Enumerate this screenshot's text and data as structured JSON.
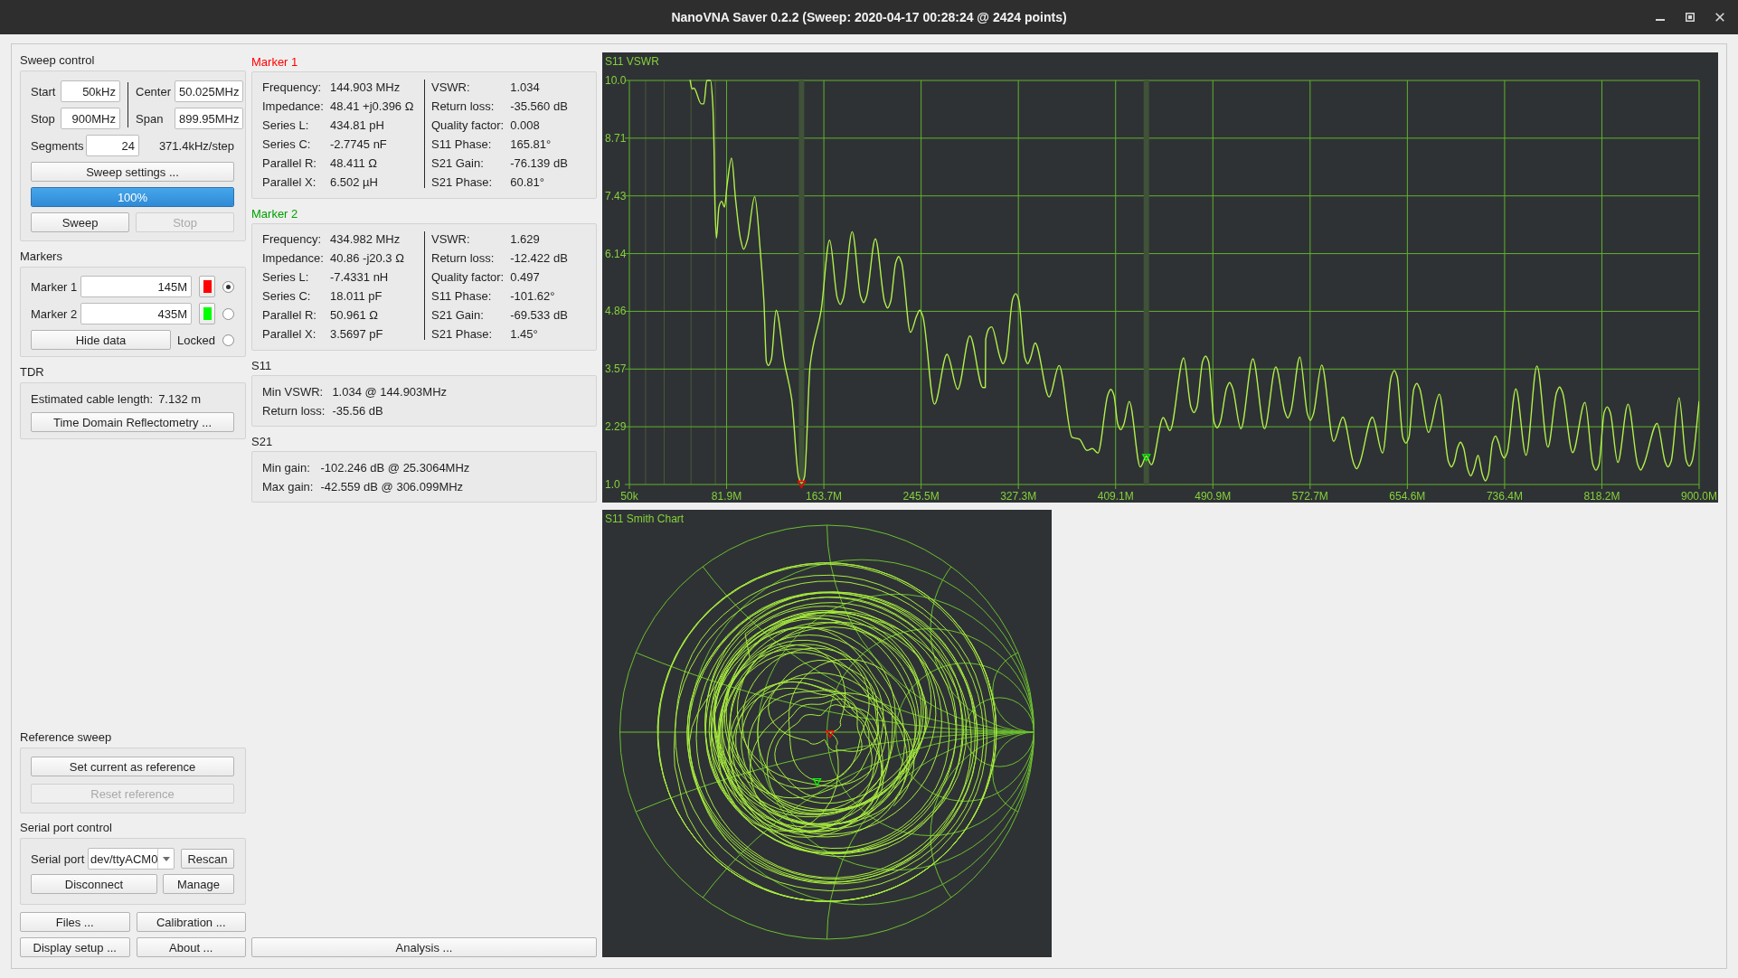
{
  "window": {
    "title": "NanoVNA Saver 0.2.2 (Sweep: 2020-04-17 00:28:24 @ 2424 points)"
  },
  "sweep_control": {
    "title": "Sweep control",
    "fields": [
      {
        "label": "Start",
        "value": "50kHz"
      },
      {
        "label": "Center",
        "value": "50.025MHz"
      },
      {
        "label": "Stop",
        "value": "900MHz"
      },
      {
        "label": "Span",
        "value": "899.95MHz"
      }
    ],
    "segments": {
      "label": "Segments",
      "value": "24",
      "step": "371.4kHz/step"
    },
    "settings_button": "Sweep settings ...",
    "progress": {
      "level": 1,
      "text": "100%"
    },
    "buttons": [
      {
        "label": "Sweep",
        "disabled": false
      },
      {
        "label": "Stop",
        "disabled": true
      }
    ]
  },
  "markers": {
    "title": "Markers",
    "items": [
      {
        "label": "Marker 1",
        "value": "145M",
        "color": "#ff0000",
        "selected": true
      },
      {
        "label": "Marker 2",
        "value": "435M",
        "color": "#00ff00",
        "selected": false
      }
    ],
    "hide_button": "Hide data",
    "locked": {
      "label": "Locked",
      "checked": false
    }
  },
  "tdr": {
    "title": "TDR",
    "cable_label": "Estimated cable length:",
    "cable_value": "7.132 m",
    "button": "Time Domain Reflectometry ..."
  },
  "reference_sweep": {
    "title": "Reference sweep",
    "buttons": [
      {
        "label": "Set current as reference",
        "disabled": false
      },
      {
        "label": "Reset reference",
        "disabled": true
      }
    ]
  },
  "serial_port": {
    "title": "Serial port control",
    "label": "Serial port",
    "port": "dev/ttyACM0",
    "rescan_button": "Rescan",
    "buttons": [
      "Disconnect",
      "Manage"
    ]
  },
  "left_buttons": [
    "Files ...",
    "Calibration ...",
    "Display setup ...",
    "About ..."
  ],
  "marker_readouts": [
    {
      "title": "Marker 1",
      "color": "#ff0000",
      "left": [
        {
          "label": "Frequency:",
          "value": "144.903 MHz"
        },
        {
          "label": "Impedance:",
          "value": "48.41 +j0.396 Ω"
        },
        {
          "label": "Series L:",
          "value": "434.81 pH"
        },
        {
          "label": "Series C:",
          "value": "-2.7745 nF"
        },
        {
          "label": "Parallel R:",
          "value": "48.411 Ω"
        },
        {
          "label": "Parallel X:",
          "value": "6.502 µH"
        }
      ],
      "right": [
        {
          "label": "VSWR:",
          "value": "1.034"
        },
        {
          "label": "Return loss:",
          "value": "-35.560 dB"
        },
        {
          "label": "Quality factor:",
          "value": "0.008"
        },
        {
          "label": "S11 Phase:",
          "value": "165.81°"
        },
        {
          "label": "S21 Gain:",
          "value": "-76.139 dB"
        },
        {
          "label": "S21 Phase:",
          "value": "60.81°"
        }
      ]
    },
    {
      "title": "Marker 2",
      "color": "#00a000",
      "left": [
        {
          "label": "Frequency:",
          "value": "434.982 MHz"
        },
        {
          "label": "Impedance:",
          "value": "40.86 -j20.3 Ω"
        },
        {
          "label": "Series L:",
          "value": "-7.4331 nH"
        },
        {
          "label": "Series C:",
          "value": "18.011 pF"
        },
        {
          "label": "Parallel R:",
          "value": "50.961 Ω"
        },
        {
          "label": "Parallel X:",
          "value": "3.5697 pF"
        }
      ],
      "right": [
        {
          "label": "VSWR:",
          "value": "1.629"
        },
        {
          "label": "Return loss:",
          "value": "-12.422 dB"
        },
        {
          "label": "Quality factor:",
          "value": "0.497"
        },
        {
          "label": "S11 Phase:",
          "value": "-101.62°"
        },
        {
          "label": "S21 Gain:",
          "value": "-69.533 dB"
        },
        {
          "label": "S21 Phase:",
          "value": "1.45°"
        }
      ]
    }
  ],
  "s11": {
    "title": "S11",
    "rows": [
      {
        "label": "Min VSWR:",
        "value": "1.034 @ 144.903MHz"
      },
      {
        "label": "Return loss:",
        "value": "-35.56 dB"
      }
    ]
  },
  "s21": {
    "title": "S21",
    "rows": [
      {
        "label": "Min gain:",
        "value": "-102.246 dB @ 25.3064MHz"
      },
      {
        "label": "Max gain:",
        "value": "-42.559 dB @ 306.099MHz"
      }
    ]
  },
  "analysis_button": "Analysis ...",
  "vswr_chart": {
    "chart_data": {
      "type": "line",
      "title": "S11 VSWR",
      "x": [
        51200000,
        52800000,
        54300000,
        60500000,
        62700000,
        65200000,
        68300000,
        70200000,
        71400000,
        72000000,
        73300000,
        75400000,
        77600000,
        80100000,
        82300000,
        86000000,
        89400000,
        93400000,
        96200000,
        99300000,
        105500000,
        110200000,
        113300000,
        115300000,
        117000000,
        119500000,
        123500000,
        130400000,
        136600000,
        142400000,
        144900000,
        147400000,
        152100000,
        161400000,
        168500000,
        175000000,
        177500000,
        180000000,
        187500000,
        194600000,
        197100000,
        199600000,
        207000000,
        214800000,
        217300000,
        219800000,
        224100000,
        226600000,
        229100000,
        236500000,
        241800000,
        244300000,
        246800000,
        256700000,
        267300000,
        276300000,
        286500000,
        297400000,
        299500000,
        299800000,
        304800000,
        311900000,
        314400000,
        316900000,
        322500000,
        325000000,
        327500000,
        332700000,
        335200000,
        337700000,
        341400000,
        353200000,
        361600000,
        372500000,
        378700000,
        384900000,
        389600000,
        394200000,
        402600000,
        405100000,
        407600000,
        411000000,
        413500000,
        416000000,
        420600000,
        429900000,
        435000000,
        439200000,
        449200000,
        454800000,
        466400000,
        472500000,
        475000000,
        477500000,
        482300000,
        484800000,
        487300000,
        492100000,
        494600000,
        497100000,
        502500000,
        505000000,
        507500000,
        514500000,
        524600000,
        534400000,
        543900000,
        551500000,
        554000000,
        556500000,
        564100000,
        570500000,
        573000000,
        575500000,
        582500000,
        592600000,
        600300000,
        609400000,
        611900000,
        614400000,
        625100000,
        633700000,
        641000000,
        643500000,
        646000000,
        650800000,
        653300000,
        655800000,
        660000000,
        662500000,
        665000000,
        672300000,
        681500000,
        689100000,
        691600000,
        694100000,
        696800000,
        699300000,
        701800000,
        705400000,
        707900000,
        710400000,
        714000000,
        717700000,
        720200000,
        722700000,
        726200000,
        728700000,
        731200000,
        734000000,
        736000000,
        738500000,
        745800000,
        754400000,
        763600000,
        772800000,
        780100000,
        782600000,
        785100000,
        793600000,
        804000000,
        810700000,
        813200000,
        815700000,
        820200000,
        822700000,
        825200000,
        831600000,
        840200000,
        848400000,
        850900000,
        853400000,
        864700000,
        871400000,
        873900000,
        876400000,
        883100000,
        889200000,
        891700000,
        894200000,
        900000000
      ],
      "values": [
        10.0,
        9.81,
        9.83,
        9.48,
        9.48,
        10.0,
        10.0,
        9.48,
        8.33,
        7.27,
        6.49,
        7.18,
        7.31,
        7.18,
        7.68,
        8.27,
        7.35,
        6.49,
        6.24,
        6.44,
        7.41,
        6.2,
        5.05,
        3.74,
        3.65,
        3.79,
        4.88,
        3.73,
        2.91,
        1.17,
        1.03,
        1.17,
        3.65,
        4.88,
        6.44,
        5.15,
        5.01,
        5.15,
        6.63,
        5.19,
        5.05,
        5.19,
        6.47,
        5.07,
        4.93,
        5.07,
        5.94,
        6.08,
        5.94,
        4.39,
        4.76,
        4.88,
        4.76,
        2.79,
        3.9,
        3.12,
        4.31,
        3.16,
        3.16,
        4.23,
        4.51,
        3.83,
        3.69,
        3.83,
        5.13,
        5.25,
        5.13,
        3.83,
        3.69,
        3.83,
        4.15,
        2.95,
        3.65,
        2.05,
        2.01,
        1.76,
        1.8,
        1.7,
        3.0,
        3.12,
        3.0,
        2.34,
        2.22,
        2.34,
        2.85,
        1.39,
        1.63,
        1.44,
        2.49,
        2.2,
        3.82,
        2.72,
        2.6,
        2.72,
        3.74,
        3.86,
        3.74,
        2.38,
        2.26,
        2.38,
        3.15,
        3.27,
        3.15,
        2.24,
        3.8,
        2.24,
        3.62,
        2.62,
        2.48,
        2.62,
        3.84,
        2.57,
        2.43,
        2.57,
        3.66,
        1.96,
        2.5,
        1.47,
        1.35,
        1.47,
        2.5,
        1.7,
        3.4,
        3.54,
        3.4,
        2.04,
        1.92,
        2.04,
        3.13,
        3.25,
        3.13,
        2.16,
        3.01,
        1.51,
        1.39,
        1.51,
        1.82,
        1.94,
        1.82,
        1.33,
        1.19,
        1.33,
        1.65,
        1.22,
        1.08,
        1.22,
        1.94,
        2.08,
        1.94,
        1.67,
        1.59,
        1.71,
        3.13,
        1.65,
        3.64,
        1.83,
        3.05,
        3.17,
        3.05,
        1.71,
        2.83,
        1.44,
        1.32,
        1.44,
        2.61,
        2.73,
        2.61,
        1.49,
        2.79,
        1.44,
        1.32,
        1.44,
        2.36,
        1.51,
        1.39,
        1.51,
        2.93,
        1.53,
        1.41,
        1.53,
        2.85
      ],
      "xlim": [
        50000,
        900000000
      ],
      "ylim": [
        1,
        10
      ],
      "xticks": [
        {
          "value": 50000,
          "label": "50k"
        },
        {
          "value": 81863636,
          "label": "81.9M"
        },
        {
          "value": 163677273,
          "label": "163.7M"
        },
        {
          "value": 245490909,
          "label": "245.5M"
        },
        {
          "value": 327304545,
          "label": "327.3M"
        },
        {
          "value": 409118182,
          "label": "409.1M"
        },
        {
          "value": 490931818,
          "label": "490.9M"
        },
        {
          "value": 572745455,
          "label": "572.7M"
        },
        {
          "value": 654559091,
          "label": "654.6M"
        },
        {
          "value": 736372727,
          "label": "736.4M"
        },
        {
          "value": 818186364,
          "label": "818.2M"
        },
        {
          "value": 900000000,
          "label": "900.0M"
        }
      ],
      "yticks": [
        {
          "value": 1,
          "label": "1.0"
        },
        {
          "value": 2.2857,
          "label": "2.29"
        },
        {
          "value": 3.5714,
          "label": "3.57"
        },
        {
          "value": 4.8571,
          "label": "4.86"
        },
        {
          "value": 6.1429,
          "label": "6.14"
        },
        {
          "value": 7.4286,
          "label": "7.43"
        },
        {
          "value": 8.7143,
          "label": "8.71"
        },
        {
          "value": 10,
          "label": "10.0"
        }
      ],
      "grid": true,
      "ref_lines": [
        {
          "axis": "x",
          "value": 144903000
        },
        {
          "axis": "x",
          "value": 434982000
        }
      ]
    },
    "markers": [
      {
        "color": "#ff0000"
      },
      {
        "color": "#00ff00"
      }
    ]
  },
  "smith_chart": {
    "title": "S11 Smith Chart",
    "markers": [
      {
        "color": "#ff0000"
      },
      {
        "color": "#00ff00"
      }
    ]
  }
}
